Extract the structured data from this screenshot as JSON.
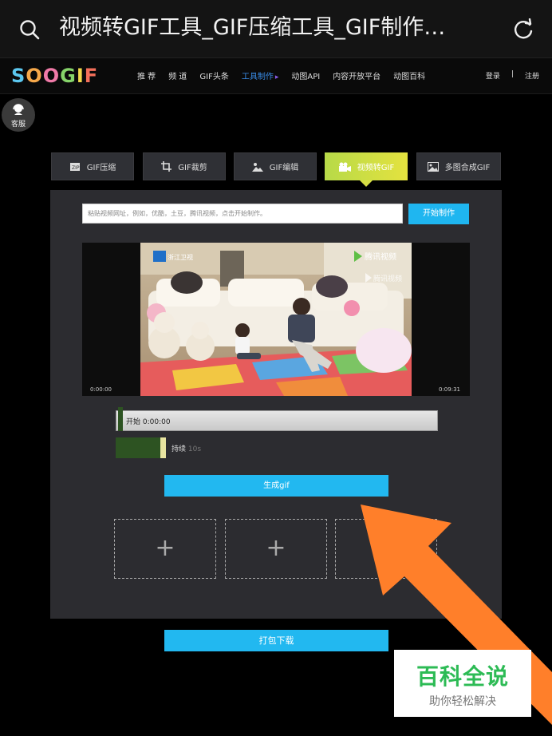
{
  "browser": {
    "title": "视频转GIF工具_GIF压缩工具_GIF制作…"
  },
  "site": {
    "logo_letters": [
      "S",
      "O",
      "O",
      "G",
      "I",
      "F"
    ],
    "nav": [
      "推 荐",
      "频 道",
      "GIF头条",
      "工具制作",
      "动图API",
      "内容开放平台",
      "动图百科"
    ],
    "active_nav_index": 3,
    "login": "登录",
    "separator": "|",
    "register": "注册"
  },
  "customer_service": {
    "label": "客服"
  },
  "tabs": [
    {
      "label": "GIF压缩",
      "icon": "zip-icon"
    },
    {
      "label": "GIF裁剪",
      "icon": "crop-icon"
    },
    {
      "label": "GIF编辑",
      "icon": "edit-image-icon"
    },
    {
      "label": "视频转GIF",
      "icon": "video-camera-icon",
      "active": true
    },
    {
      "label": "多图合成GIF",
      "icon": "image-icon"
    }
  ],
  "tool": {
    "url_placeholder": "粘贴视频网址，例如，优酷，土豆，腾讯视频，点击开始制作。",
    "start_button": "开始制作",
    "video": {
      "channel_logo": "浙江卫视",
      "watermark_1": "腾讯视频",
      "watermark_2": "腾讯视频",
      "time_start": "0:00:00",
      "time_end": "0:09:31"
    },
    "range_label": "开始 0:00:00",
    "duration_label": "持续",
    "duration_value": "10s",
    "generate_button": "生成gif",
    "slots": [
      "+",
      "+",
      "+"
    ],
    "download_button": "打包下载"
  },
  "watermark": {
    "title": "百科全说",
    "subtitle": "助你轻松解决"
  },
  "colors": {
    "accent_blue": "#22b8f0",
    "active_tab": "#d6de44",
    "arrow": "#ff7f2a",
    "watermark_green": "#2dbb55"
  }
}
